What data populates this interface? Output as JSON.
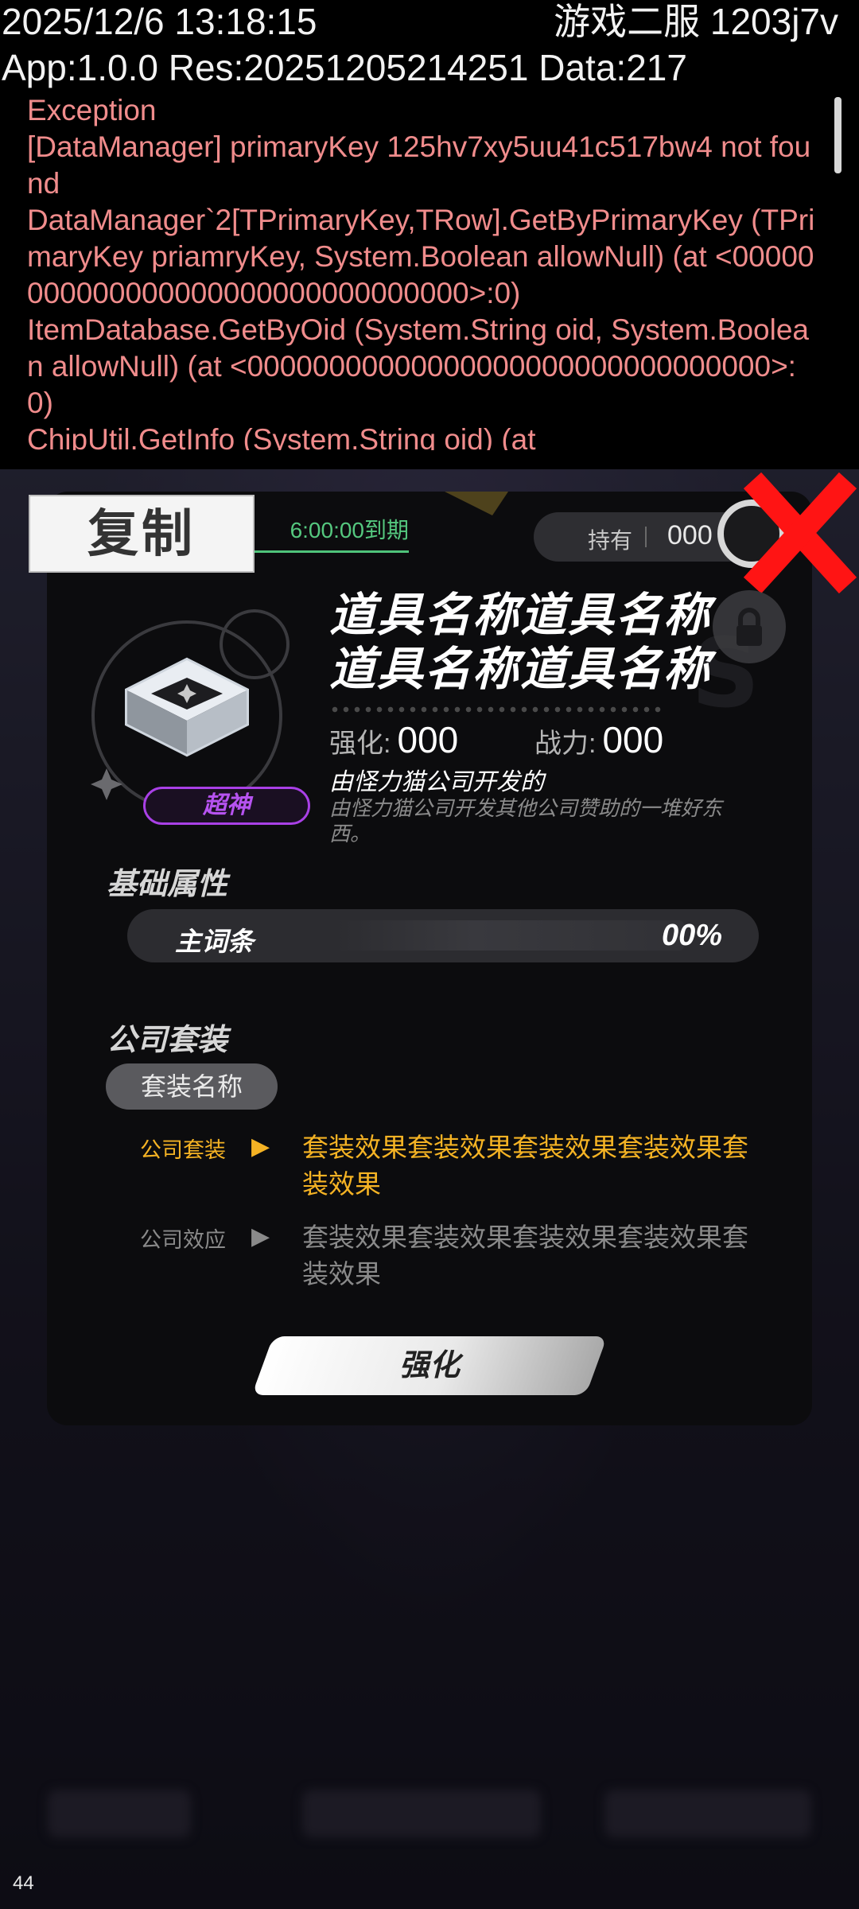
{
  "debug": {
    "timestamp": "2025/12/6 13:18:15",
    "server": "游戏二服 1203j7v",
    "version_info": "App:1.0.0 Res:20251205214251 Data:217",
    "log": "Exception\n[DataManager] primaryKey 125hv7xy5uu41c517bw4 not found\nDataManager`2[TPrimaryKey,TRow].GetByPrimaryKey (TPrimaryKey priamryKey, System.Boolean allowNull) (at <00000000000000000000000000000000>:0)\nItemDatabase.GetByOid (System.String oid, System.Boolean allowNull) (at <00000000000000000000000000000000>:0)\nChipUtil.GetInfo (System.String oid) (at"
  },
  "card": {
    "copy_label": "复制",
    "expire_text": "6:00:00到期",
    "own_label": "持有",
    "own_value": "000",
    "rarity": "超神",
    "item_name": "道具名称道具名称道具名称道具名称",
    "stats": {
      "enhance_label": "强化:",
      "enhance_value": "000",
      "power_label": "战力:",
      "power_value": "000"
    },
    "maker": "由怪力猫公司开发的",
    "description": "由怪力猫公司开发其他公司赞助的一堆好东西。",
    "base_attr_title": "基础属性",
    "main_attr_name": "主词条",
    "main_attr_value": "00%",
    "company_suit_title": "公司套装",
    "suit_name": "套装名称",
    "effects": [
      {
        "label": "公司套装",
        "text": "套装效果套装效果套装效果套装效果套装效果",
        "active": true
      },
      {
        "label": "公司效应",
        "text": "套装效果套装效果套装效果套装效果套装效果",
        "active": false
      }
    ],
    "strengthen_button": "强化"
  },
  "fps": "44",
  "colors": {
    "active_effect": "#f5b324",
    "inactive_effect": "#8a8a8a",
    "rarity": "#b653f0",
    "expire": "#55c87f",
    "close_x": "#ff1414",
    "log_text": "#f08c8c"
  }
}
